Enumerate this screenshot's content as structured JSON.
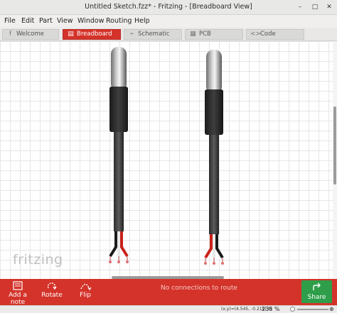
{
  "window": {
    "title": "Untitled Sketch.fzz* - Fritzing - [Breadboard View]",
    "controls": {
      "minimize": "–",
      "maximize": "□",
      "close": "✕"
    }
  },
  "menu": [
    "File",
    "Edit",
    "Part",
    "View",
    "Window",
    "Routing",
    "Help"
  ],
  "tabs": [
    {
      "label": "Welcome",
      "icon": "welcome-icon",
      "glyph": "f",
      "active": false
    },
    {
      "label": "Breadboard",
      "icon": "breadboard-icon",
      "glyph": "▤",
      "active": true
    },
    {
      "label": "Schematic",
      "icon": "schematic-icon",
      "glyph": "⌁",
      "active": false
    },
    {
      "label": "PCB",
      "icon": "pcb-icon",
      "glyph": "▦",
      "active": false
    },
    {
      "label": "Code",
      "icon": "code-icon",
      "glyph": "<>",
      "active": false
    }
  ],
  "canvas": {
    "watermark": "fritzing",
    "parts": [
      {
        "name": "temperature-probe",
        "wires": [
          "black",
          "white",
          "red"
        ]
      },
      {
        "name": "temperature-probe",
        "wires": [
          "red",
          "white",
          "black"
        ]
      }
    ]
  },
  "toolbar": {
    "add_note": "Add a note",
    "rotate": "Rotate",
    "flip": "Flip",
    "status": "No connections to route",
    "share": "Share"
  },
  "statusbar": {
    "coords": "(x,y)=(4.545, -0.219) in",
    "zoom": "238 %"
  },
  "colors": {
    "accent": "#d4332a",
    "share": "#2e9e4a",
    "wire_red": "#c8221a",
    "wire_black": "#1a1a1a",
    "wire_white": "#e8e8e8"
  }
}
